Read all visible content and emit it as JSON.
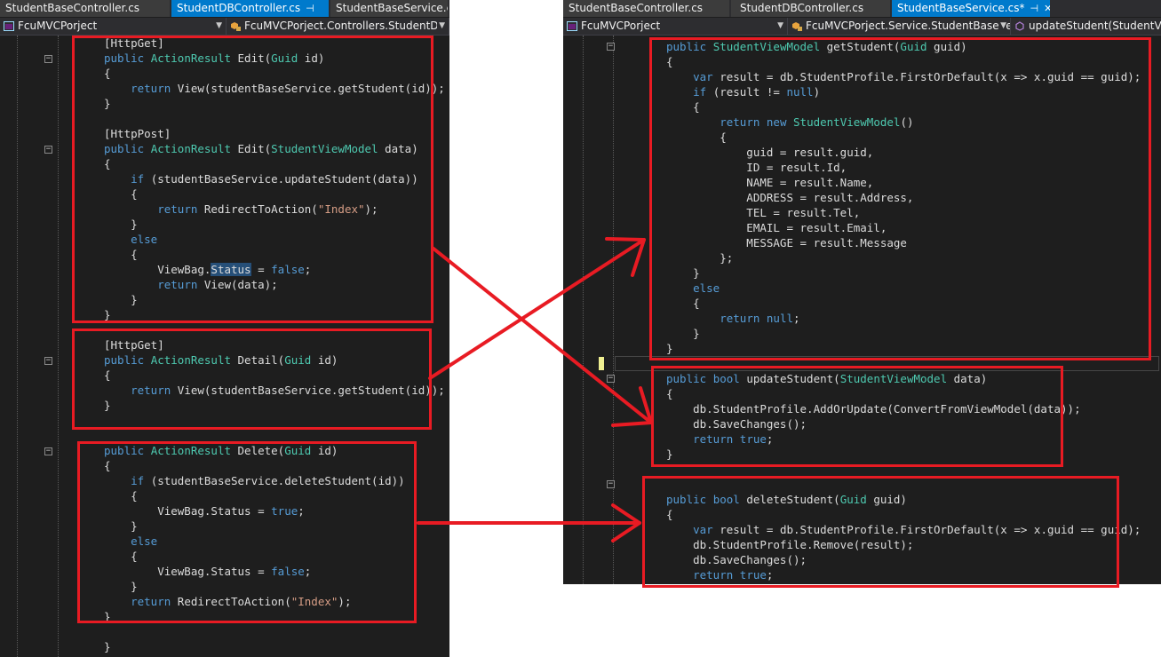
{
  "left_window": {
    "tabs": [
      {
        "label": "StudentBaseController.cs",
        "pin": "",
        "active": false
      },
      {
        "label": "StudentDBController.cs",
        "pin": "⊣",
        "active": true
      },
      {
        "label": "StudentBaseService.cs",
        "pin": "",
        "active": false
      }
    ],
    "nav": {
      "project": "FcuMVCPorject",
      "scope": "FcuMVCPorject.Controllers.StudentDB"
    },
    "lines": [
      [
        [
          "",
          "[HttpGet]"
        ]
      ],
      [
        [
          "kw",
          "public"
        ],
        [
          "",
          " "
        ],
        [
          "ty",
          "ActionResult"
        ],
        [
          "",
          " Edit("
        ],
        [
          "ty",
          "Guid"
        ],
        [
          "",
          " id)"
        ]
      ],
      [
        [
          "",
          "{"
        ]
      ],
      [
        [
          "",
          "    "
        ],
        [
          "kw",
          "return"
        ],
        [
          "",
          " View(studentBaseService.getStudent(id));"
        ]
      ],
      [
        [
          "",
          "}"
        ]
      ],
      [],
      [
        [
          "",
          "[HttpPost]"
        ]
      ],
      [
        [
          "kw",
          "public"
        ],
        [
          "",
          " "
        ],
        [
          "ty",
          "ActionResult"
        ],
        [
          "",
          " Edit("
        ],
        [
          "ty",
          "StudentViewModel"
        ],
        [
          "",
          " data)"
        ]
      ],
      [
        [
          "",
          "{"
        ]
      ],
      [
        [
          "",
          "    "
        ],
        [
          "kw",
          "if"
        ],
        [
          "",
          " (studentBaseService.updateStudent(data))"
        ]
      ],
      [
        [
          "",
          "    {"
        ]
      ],
      [
        [
          "",
          "        "
        ],
        [
          "kw",
          "return"
        ],
        [
          "",
          " RedirectToAction("
        ],
        [
          "st",
          "\"Index\""
        ],
        [
          "",
          ");"
        ]
      ],
      [
        [
          "",
          "    }"
        ]
      ],
      [
        [
          "",
          "    "
        ],
        [
          "kw",
          "else"
        ]
      ],
      [
        [
          "",
          "    {"
        ]
      ],
      [
        [
          "",
          "        ViewBag."
        ],
        [
          "hl",
          "Status"
        ],
        [
          "",
          " = "
        ],
        [
          "kw",
          "false"
        ],
        [
          "",
          ";"
        ]
      ],
      [
        [
          "",
          "        "
        ],
        [
          "kw",
          "return"
        ],
        [
          "",
          " View(data);"
        ]
      ],
      [
        [
          "",
          "    }"
        ]
      ],
      [
        [
          "",
          "}"
        ]
      ],
      [],
      [
        [
          "",
          "[HttpGet]"
        ]
      ],
      [
        [
          "kw",
          "public"
        ],
        [
          "",
          " "
        ],
        [
          "ty",
          "ActionResult"
        ],
        [
          "",
          " Detail("
        ],
        [
          "ty",
          "Guid"
        ],
        [
          "",
          " id)"
        ]
      ],
      [
        [
          "",
          "{"
        ]
      ],
      [
        [
          "",
          "    "
        ],
        [
          "kw",
          "return"
        ],
        [
          "",
          " View(studentBaseService.getStudent(id));"
        ]
      ],
      [
        [
          "",
          "}"
        ]
      ],
      [],
      [],
      [
        [
          "kw",
          "public"
        ],
        [
          "",
          " "
        ],
        [
          "ty",
          "ActionResult"
        ],
        [
          "",
          " Delete("
        ],
        [
          "ty",
          "Guid"
        ],
        [
          "",
          " id)"
        ]
      ],
      [
        [
          "",
          "{"
        ]
      ],
      [
        [
          "",
          "    "
        ],
        [
          "kw",
          "if"
        ],
        [
          "",
          " (studentBaseService.deleteStudent(id))"
        ]
      ],
      [
        [
          "",
          "    {"
        ]
      ],
      [
        [
          "",
          "        ViewBag.Status = "
        ],
        [
          "kw",
          "true"
        ],
        [
          "",
          ";"
        ]
      ],
      [
        [
          "",
          "    }"
        ]
      ],
      [
        [
          "",
          "    "
        ],
        [
          "kw",
          "else"
        ]
      ],
      [
        [
          "",
          "    {"
        ]
      ],
      [
        [
          "",
          "        ViewBag.Status = "
        ],
        [
          "kw",
          "false"
        ],
        [
          "",
          ";"
        ]
      ],
      [
        [
          "",
          "    }"
        ]
      ],
      [
        [
          "",
          "    "
        ],
        [
          "kw",
          "return"
        ],
        [
          "",
          " RedirectToAction("
        ],
        [
          "st",
          "\"Index\""
        ],
        [
          "",
          ");"
        ]
      ],
      [
        [
          "",
          "}"
        ]
      ],
      [],
      [
        [
          "",
          "}"
        ]
      ]
    ]
  },
  "right_window": {
    "tabs": [
      {
        "label": "StudentBaseController.cs",
        "pin": "",
        "active": false
      },
      {
        "label": "StudentDBController.cs",
        "pin": "",
        "active": false
      },
      {
        "label": "StudentBaseService.cs*",
        "pin": "⊣",
        "close": "✕",
        "active": true
      }
    ],
    "nav": {
      "project": "FcuMVCPorject",
      "scope": "FcuMVCPorject.Service.StudentBaseSe",
      "member": "updateStudent(StudentVie"
    },
    "lines": [
      [
        [
          "kw",
          "public"
        ],
        [
          "",
          " "
        ],
        [
          "ty",
          "StudentViewModel"
        ],
        [
          "",
          " getStudent("
        ],
        [
          "ty",
          "Guid"
        ],
        [
          "",
          " guid)"
        ]
      ],
      [
        [
          "",
          "{"
        ]
      ],
      [
        [
          "",
          "    "
        ],
        [
          "kw",
          "var"
        ],
        [
          "",
          " result = db.StudentProfile.FirstOrDefault(x => x.guid == guid);"
        ]
      ],
      [
        [
          "",
          "    "
        ],
        [
          "kw",
          "if"
        ],
        [
          "",
          " (result != "
        ],
        [
          "kw",
          "null"
        ],
        [
          "",
          ")"
        ]
      ],
      [
        [
          "",
          "    {"
        ]
      ],
      [
        [
          "",
          "        "
        ],
        [
          "kw",
          "return"
        ],
        [
          "",
          " "
        ],
        [
          "kw",
          "new"
        ],
        [
          "",
          " "
        ],
        [
          "ty",
          "StudentViewModel"
        ],
        [
          "",
          "()"
        ]
      ],
      [
        [
          "",
          "        {"
        ]
      ],
      [
        [
          "",
          "            guid = result.guid,"
        ]
      ],
      [
        [
          "",
          "            ID = result.Id,"
        ]
      ],
      [
        [
          "",
          "            NAME = result.Name,"
        ]
      ],
      [
        [
          "",
          "            ADDRESS = result.Address,"
        ]
      ],
      [
        [
          "",
          "            TEL = result.Tel,"
        ]
      ],
      [
        [
          "",
          "            EMAIL = result.Email,"
        ]
      ],
      [
        [
          "",
          "            MESSAGE = result.Message"
        ]
      ],
      [
        [
          "",
          "        };"
        ]
      ],
      [
        [
          "",
          "    }"
        ]
      ],
      [
        [
          "",
          "    "
        ],
        [
          "kw",
          "else"
        ]
      ],
      [
        [
          "",
          "    {"
        ]
      ],
      [
        [
          "",
          "        "
        ],
        [
          "kw",
          "return"
        ],
        [
          "",
          " "
        ],
        [
          "kw",
          "null"
        ],
        [
          "",
          ";"
        ]
      ],
      [
        [
          "",
          "    }"
        ]
      ],
      [
        [
          "",
          "}"
        ]
      ],
      [],
      [
        [
          "kw",
          "public"
        ],
        [
          "",
          " "
        ],
        [
          "kw",
          "bool"
        ],
        [
          "",
          " updateStudent("
        ],
        [
          "ty",
          "StudentViewModel"
        ],
        [
          "",
          " data)"
        ]
      ],
      [
        [
          "",
          "{"
        ]
      ],
      [
        [
          "",
          "    db.StudentProfile.AddOrUpdate(ConvertFromViewModel(data));"
        ]
      ],
      [
        [
          "",
          "    db.SaveChanges();"
        ]
      ],
      [
        [
          "",
          "    "
        ],
        [
          "kw",
          "return"
        ],
        [
          "",
          " "
        ],
        [
          "kw",
          "true"
        ],
        [
          "",
          ";"
        ]
      ],
      [
        [
          "",
          "}"
        ]
      ],
      [],
      [],
      [
        [
          "kw",
          "public"
        ],
        [
          "",
          " "
        ],
        [
          "kw",
          "bool"
        ],
        [
          "",
          " deleteStudent("
        ],
        [
          "ty",
          "Guid"
        ],
        [
          "",
          " guid)"
        ]
      ],
      [
        [
          "",
          "{"
        ]
      ],
      [
        [
          "",
          "    "
        ],
        [
          "kw",
          "var"
        ],
        [
          "",
          " result = db.StudentProfile.FirstOrDefault(x => x.guid == guid);"
        ]
      ],
      [
        [
          "",
          "    db.StudentProfile.Remove(result);"
        ]
      ],
      [
        [
          "",
          "    db.SaveChanges();"
        ]
      ],
      [
        [
          "",
          "    "
        ],
        [
          "kw",
          "return"
        ],
        [
          "",
          " "
        ],
        [
          "kw",
          "true"
        ],
        [
          "",
          ";"
        ]
      ],
      [
        [
          "",
          "}"
        ]
      ]
    ]
  },
  "colors": {
    "editor_bg": "#1e1e1e",
    "keyword": "#569cd6",
    "type": "#4ec9b0",
    "string": "#d69d85",
    "annotation_red": "#e81b23",
    "active_tab": "#007acc"
  },
  "icons": [
    "csharp-project-icon",
    "class-icon",
    "method-icon",
    "pin-icon",
    "close-icon",
    "chevron-down-icon",
    "fold-collapse-icon"
  ]
}
